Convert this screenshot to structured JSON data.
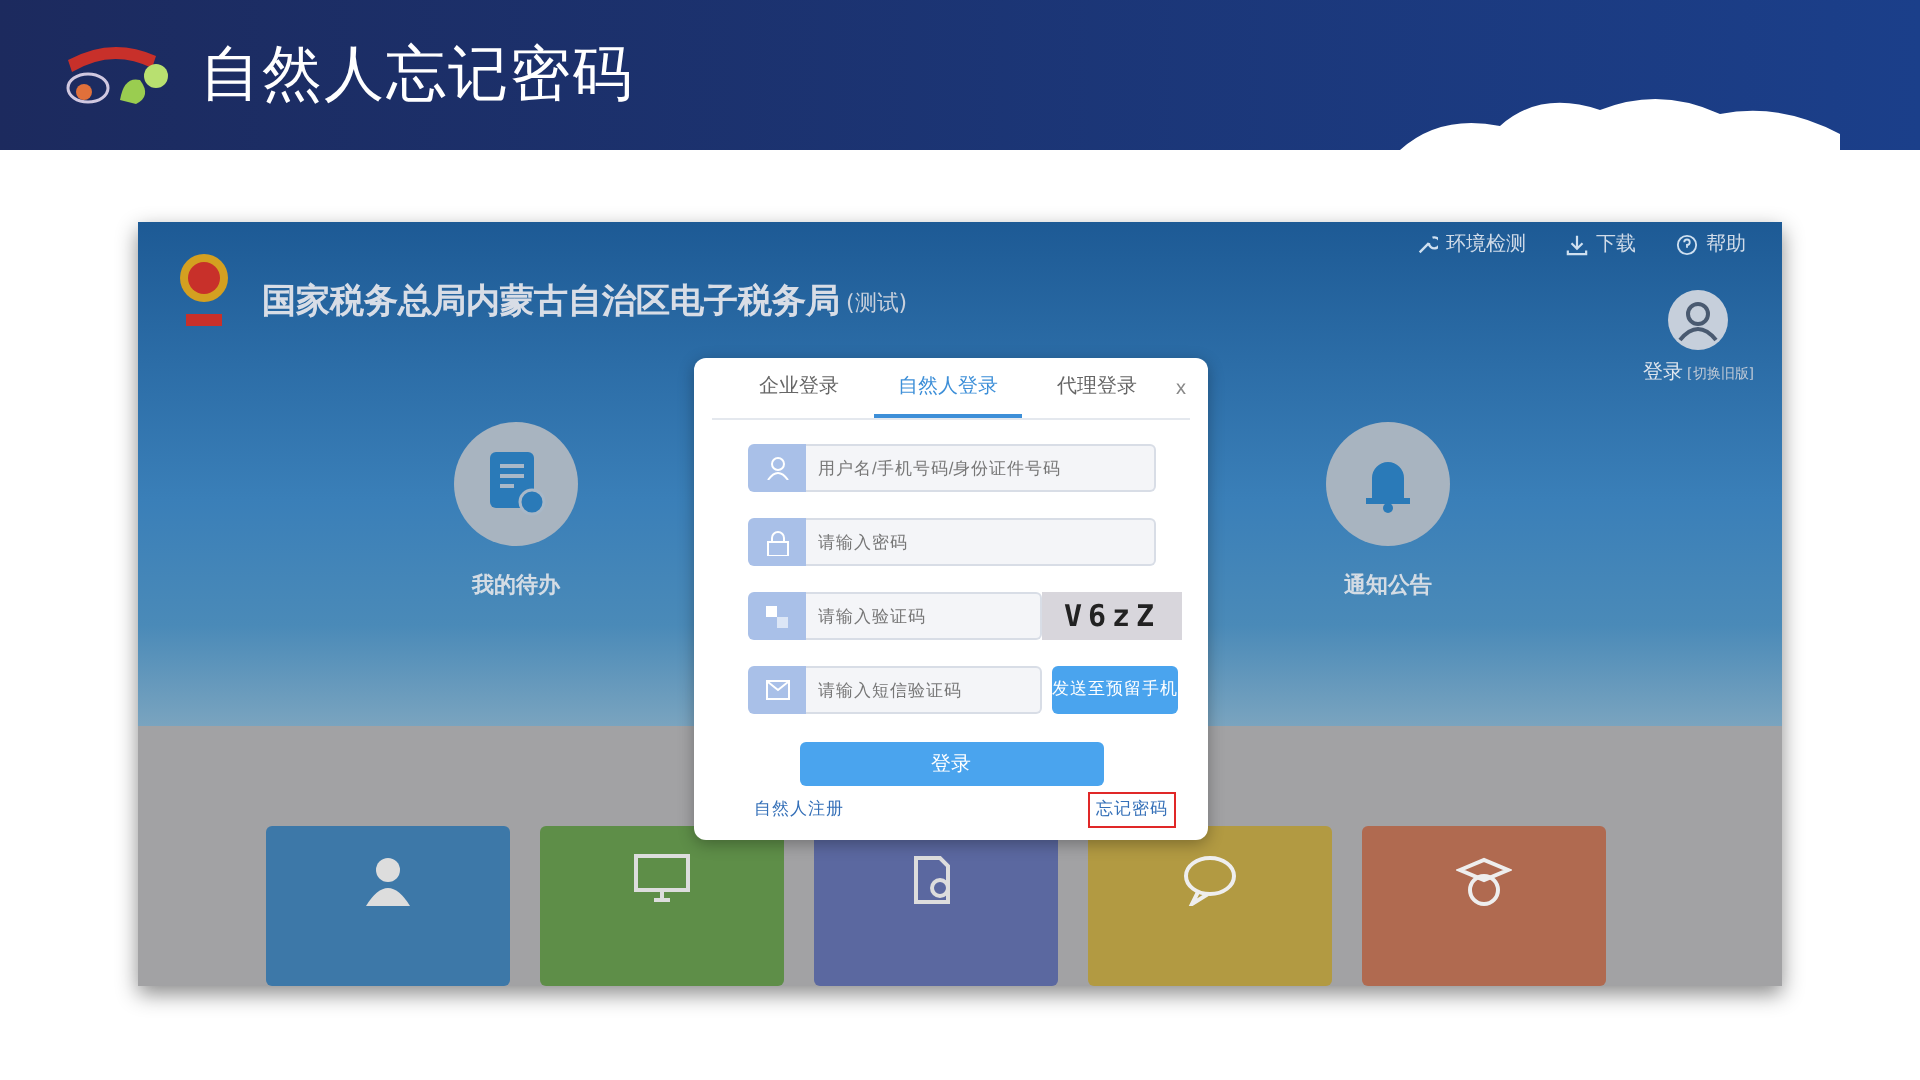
{
  "slide": {
    "title": "自然人忘记密码"
  },
  "site": {
    "title": "国家税务总局内蒙古自治区电子税务局",
    "title_note": "(测试)",
    "top_links": [
      {
        "kind": "env",
        "label": "环境检测"
      },
      {
        "kind": "download",
        "label": "下载"
      },
      {
        "kind": "help",
        "label": "帮助"
      }
    ],
    "user": {
      "login": "登录",
      "switch": "[切换旧版]"
    },
    "shortcuts": [
      {
        "kind": "todo",
        "label": "我的待办"
      },
      {
        "kind": "notice",
        "label": "通知公告"
      }
    ],
    "tiles": [
      {
        "kind": "person",
        "color": "#3d78a8"
      },
      {
        "kind": "monitor",
        "color": "#5e8e48"
      },
      {
        "kind": "search-doc",
        "color": "#5b68a0"
      },
      {
        "kind": "chat",
        "color": "#b29a42"
      },
      {
        "kind": "graduate",
        "color": "#b06a50"
      }
    ]
  },
  "login_dialog": {
    "close": "x",
    "tabs": [
      {
        "label": "企业登录",
        "selected": false
      },
      {
        "label": "自然人登录",
        "selected": true
      },
      {
        "label": "代理登录",
        "selected": false
      }
    ],
    "fields": [
      {
        "kind": "user",
        "placeholder": "用户名/手机号码/身份证件号码"
      },
      {
        "kind": "lock",
        "placeholder": "请输入密码"
      },
      {
        "kind": "captcha",
        "placeholder": "请输入验证码",
        "captcha": "V6zZ"
      },
      {
        "kind": "sms",
        "placeholder": "请输入短信验证码",
        "button": "发送至预留手机"
      }
    ],
    "submit": "登录",
    "links": [
      {
        "label": "自然人注册",
        "highlighted": false
      },
      {
        "label": "忘记密码",
        "highlighted": true
      }
    ]
  }
}
